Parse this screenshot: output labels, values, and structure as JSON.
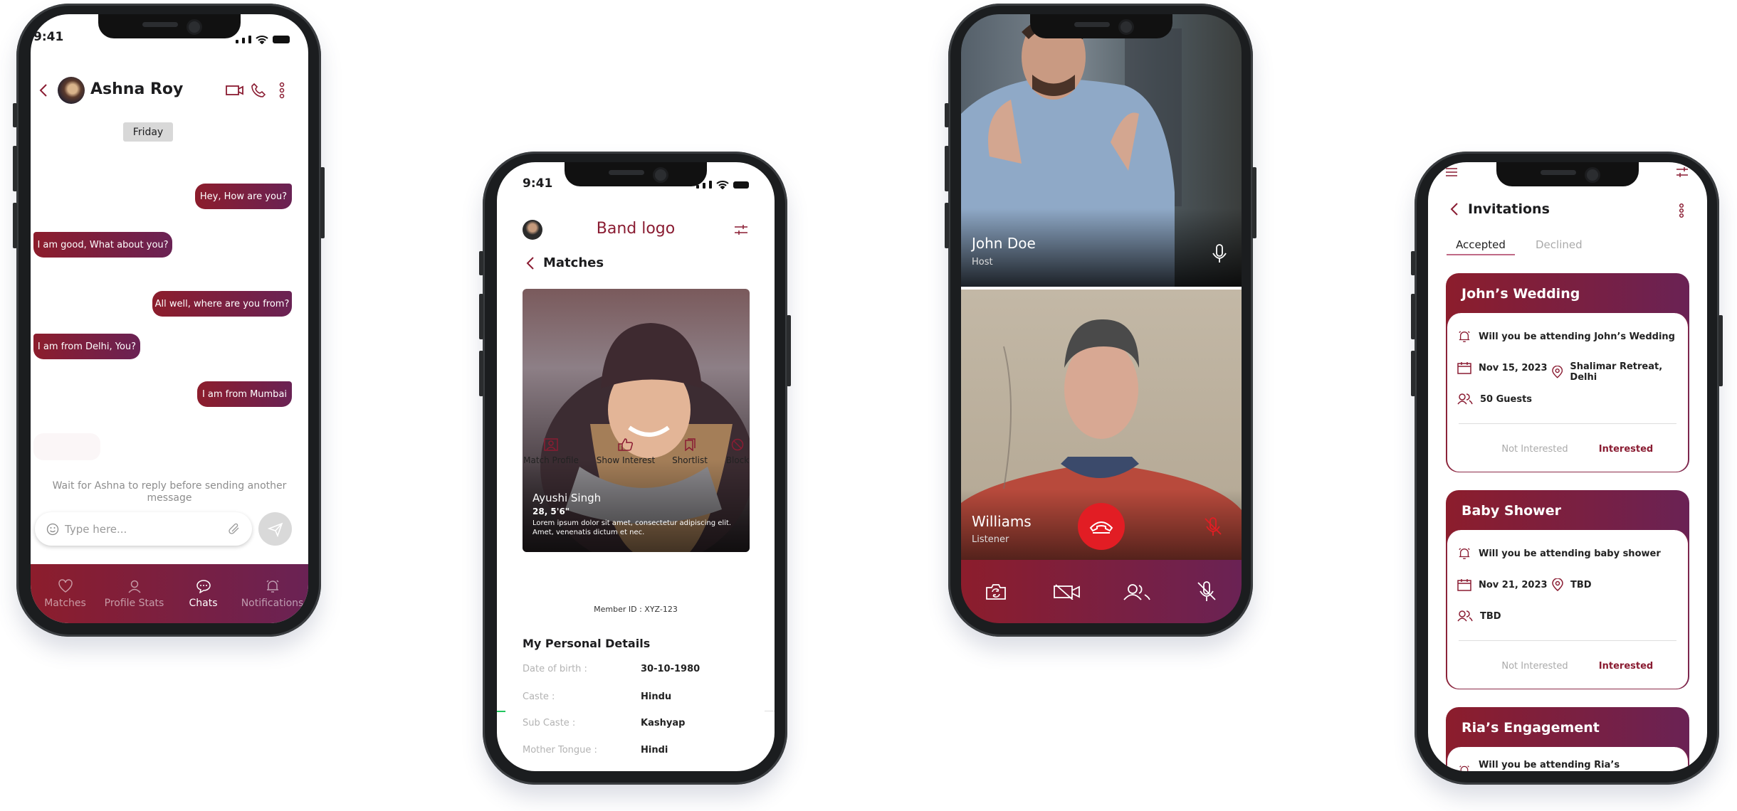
{
  "colors": {
    "primary": "#8a1c32",
    "gradient_start": "#8c1d2c",
    "gradient_end": "#6a2254",
    "end_call": "#e21d24"
  },
  "chat": {
    "status_time": "9:41",
    "contact_name": "Ashna Roy",
    "date_label": "Friday",
    "messages": [
      {
        "side": "sent",
        "text": "Hey, How are you?"
      },
      {
        "side": "received",
        "text": "I am good, What about you?"
      },
      {
        "side": "sent",
        "text": "All well, where are you from?"
      },
      {
        "side": "received",
        "text": "I am from Delhi, You?"
      },
      {
        "side": "sent",
        "text": "I am from Mumbai"
      }
    ],
    "wait_notice": "Wait for Ashna to reply before sending another message",
    "input_placeholder": "Type here...",
    "nav": [
      {
        "label": "Matches",
        "icon": "heart-icon"
      },
      {
        "label": "Profile Stats",
        "icon": "user-icon"
      },
      {
        "label": "Chats",
        "icon": "chat-icon",
        "active": true
      },
      {
        "label": "Notifications",
        "icon": "bell-icon"
      }
    ]
  },
  "profile": {
    "status_time": "9:41",
    "brand": "Band logo",
    "page_title": "Matches",
    "match": {
      "name": "Ayushi Singh",
      "age_height": "28, 5'6\"",
      "bio": "Lorem ipsum dolor sit amet, consectetur adipiscing elit. Amet, venenatis dictum et nec."
    },
    "actions": [
      {
        "label": "Match Profile",
        "icon": "profile-card-icon"
      },
      {
        "label": "Show Interest",
        "icon": "thumbs-up-icon"
      },
      {
        "label": "Shortlist",
        "icon": "bookmark-icon"
      },
      {
        "label": "Block",
        "icon": "block-icon"
      }
    ],
    "member_id": "Member ID : XYZ-123",
    "section_title": "My Personal Details",
    "details": [
      {
        "label": "Date of birth :",
        "value": "30-10-1980"
      },
      {
        "label": "Caste :",
        "value": "Hindu"
      },
      {
        "label": "Sub Caste :",
        "value": "Kashyap"
      },
      {
        "label": "Mother Tongue :",
        "value": "Hindi"
      }
    ]
  },
  "call": {
    "host": {
      "name": "John Doe",
      "role": "Host"
    },
    "listener": {
      "name": "Williams",
      "role": "Listener"
    }
  },
  "invitations": {
    "title": "Invitations",
    "tabs": [
      "Accepted",
      "Declined"
    ],
    "active_tab": "Accepted",
    "not_interested_label": "Not Interested",
    "interested_label": "Interested",
    "cards": [
      {
        "title": "John’s Wedding",
        "question": "Will you be attending John’s Wedding",
        "date": "Nov 15, 2023",
        "location": "Shalimar Retreat, Delhi",
        "guests": "50 Guests"
      },
      {
        "title": "Baby Shower",
        "question": "Will you be attending baby shower",
        "date": "Nov 21, 2023",
        "location": "TBD",
        "guests": "TBD"
      },
      {
        "title": "Ria’s Engagement",
        "question": "Will you be attending Ria’s Engagement"
      }
    ]
  }
}
